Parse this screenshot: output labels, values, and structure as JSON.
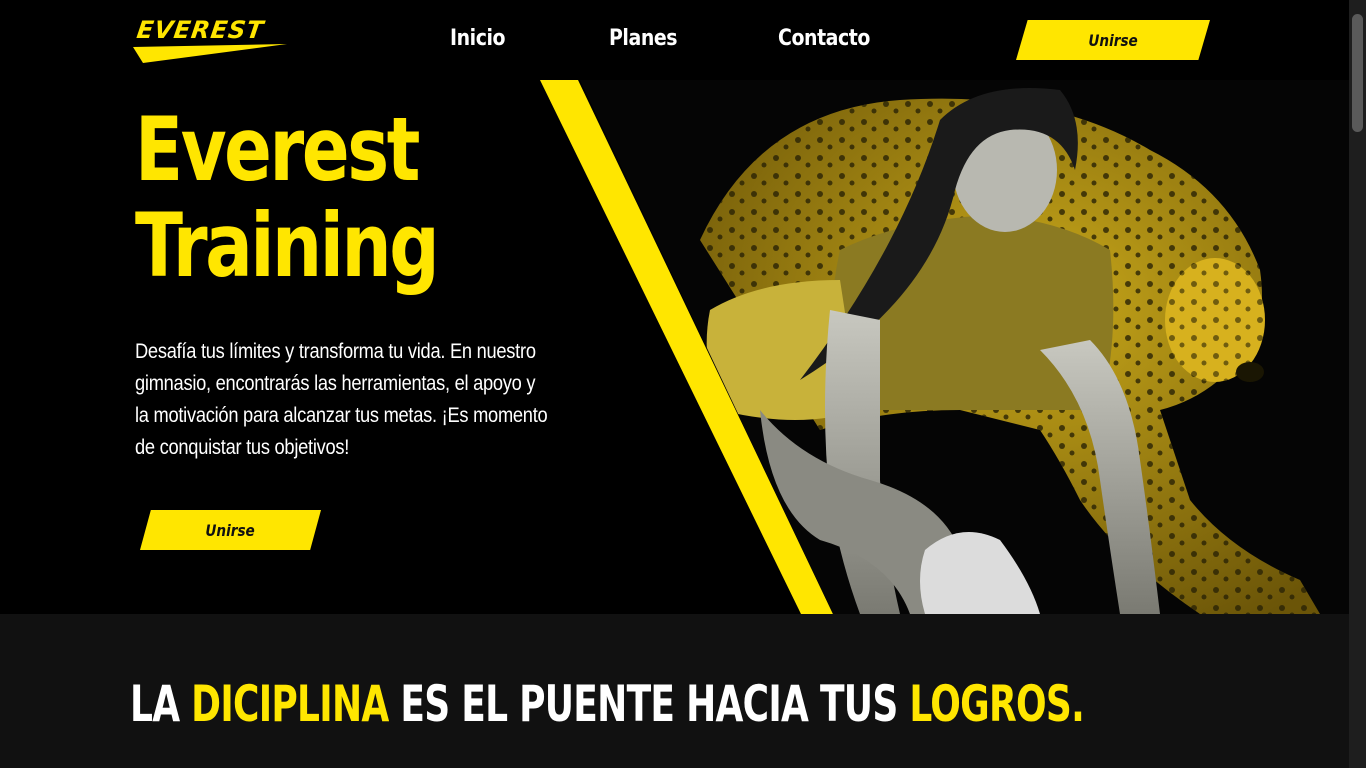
{
  "header": {
    "logo_text": "EVEREST",
    "nav": [
      {
        "label": "Inicio"
      },
      {
        "label": "Planes"
      },
      {
        "label": "Contacto"
      }
    ],
    "join_label": "Unirse"
  },
  "hero": {
    "title_line1": "Everest",
    "title_line2": "Training",
    "description": "Desafía tus límites y transforma tu vida. En nuestro gimnasio, encontrarás las herramientas, el apoyo y la motivación para alcanzar tus metas. ¡Es momento de conquistar tus objetivos!",
    "join_label": "Unirse"
  },
  "slogan": {
    "part1": "LA ",
    "highlight1": "DICIPLINA",
    "part2": " ES EL PUENTE HACIA TUS ",
    "highlight2": "LOGROS."
  },
  "colors": {
    "accent": "#ffe600",
    "background": "#000000",
    "section_bg": "#111111",
    "text": "#ffffff"
  }
}
